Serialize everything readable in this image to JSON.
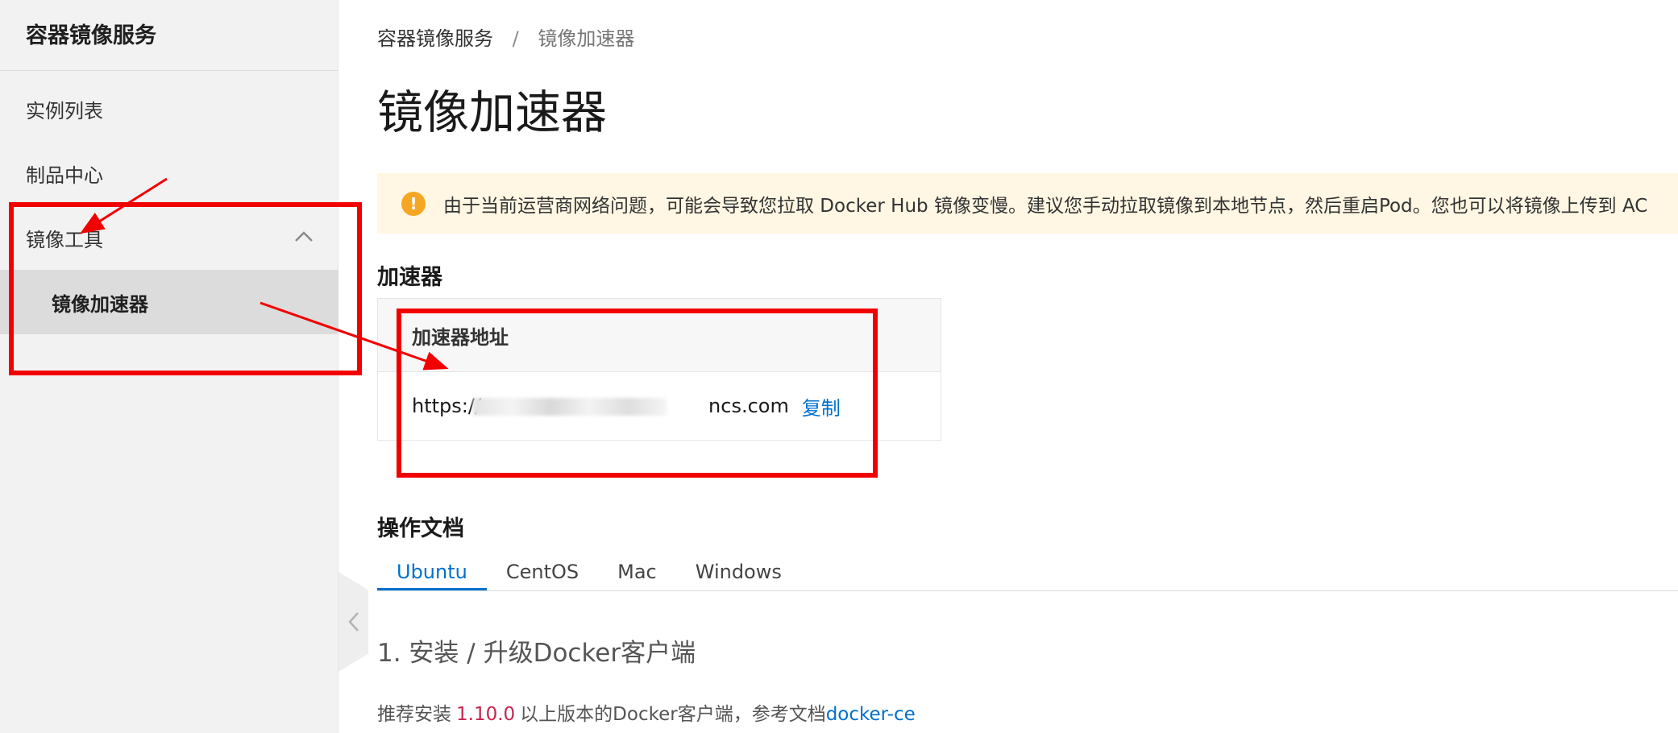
{
  "sidebar": {
    "title": "容器镜像服务",
    "items": [
      {
        "label": "实例列表"
      },
      {
        "label": "制品中心"
      },
      {
        "label": "镜像工具",
        "icon": "chevron-up-icon"
      },
      {
        "label": "镜像加速器"
      }
    ]
  },
  "breadcrumb": {
    "root": "容器镜像服务",
    "separator": "/",
    "current": "镜像加速器"
  },
  "page": {
    "title": "镜像加速器"
  },
  "alert": {
    "icon": "warning-icon",
    "icon_glyph": "!",
    "text": "由于当前运营商网络问题，可能会导致您拉取 Docker Hub 镜像变慢。建议您手动拉取镜像到本地节点，然后重启Pod。您也可以将镜像上传到 AC"
  },
  "accelerator": {
    "section_title": "加速器",
    "header": "加速器地址",
    "url_prefix": "https://",
    "url_suffix": "ncs.com",
    "copy_label": "复制"
  },
  "docs": {
    "section_title": "操作文档",
    "tabs": [
      {
        "label": "Ubuntu",
        "active": true
      },
      {
        "label": "CentOS"
      },
      {
        "label": "Mac"
      },
      {
        "label": "Windows"
      }
    ],
    "step1_title": "1. 安装 / 升级Docker客户端",
    "step1_prefix": "推荐安装",
    "step1_version": "1.10.0",
    "step1_middle": "以上版本的Docker客户端，参考文档",
    "step1_link": "docker-ce"
  },
  "colors": {
    "accent": "#0070cc",
    "annotation": "#f20000",
    "alert_bg": "#fff7e3",
    "alert_icon": "#f5a623",
    "version_text": "#c7254e"
  }
}
